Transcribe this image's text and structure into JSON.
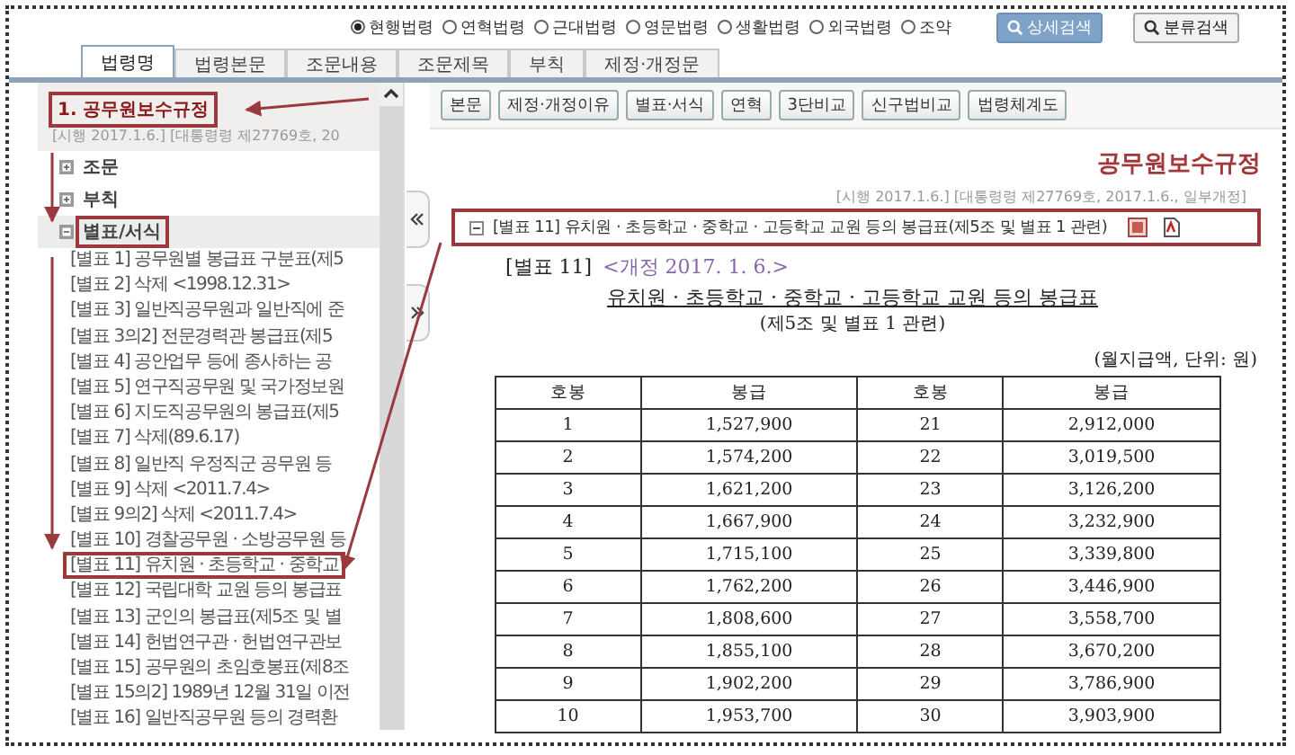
{
  "search_scope": {
    "options": [
      {
        "label": "현행법령",
        "selected": true
      },
      {
        "label": "연혁법령",
        "selected": false
      },
      {
        "label": "근대법령",
        "selected": false
      },
      {
        "label": "영문법령",
        "selected": false
      },
      {
        "label": "생활법령",
        "selected": false
      },
      {
        "label": "외국법령",
        "selected": false
      },
      {
        "label": "조약",
        "selected": false
      }
    ],
    "buttons": [
      {
        "kind": "primary",
        "label": "상세검색"
      },
      {
        "kind": "plain",
        "label": "분류검색"
      }
    ]
  },
  "tabs": [
    {
      "label": "법령명",
      "selected": true
    },
    {
      "label": "법령본문",
      "selected": false
    },
    {
      "label": "조문내용",
      "selected": false
    },
    {
      "label": "조문제목",
      "selected": false
    },
    {
      "label": "부칙",
      "selected": false
    },
    {
      "label": "제정·개정문",
      "selected": false
    }
  ],
  "sidebar": {
    "title": "1. 공무원보수규정",
    "title_boxed": true,
    "subtitle": "[시행 2017.1.6.] [대통령령 제27769호, 20",
    "tree": [
      {
        "label": "조문",
        "expanded": false,
        "boxed": false
      },
      {
        "label": "부칙",
        "expanded": false,
        "boxed": false
      },
      {
        "label": "별표/서식",
        "expanded": true,
        "boxed": true,
        "children": [
          {
            "label": "[별표 1] 공무원별 봉급표 구분표(제5",
            "selected": false
          },
          {
            "label": "[별표 2] 삭제 <1998.12.31>",
            "selected": false
          },
          {
            "label": "[별표 3] 일반직공무원과 일반직에 준",
            "selected": false
          },
          {
            "label": "[별표 3의2] 전문경력관 봉급표(제5",
            "selected": false
          },
          {
            "label": "[별표 4] 공안업무 등에 종사하는 공",
            "selected": false
          },
          {
            "label": "[별표 5] 연구직공무원 및 국가정보원",
            "selected": false
          },
          {
            "label": "[별표 6] 지도직공무원의 봉급표(제5",
            "selected": false
          },
          {
            "label": "[별표 7] 삭제(89.6.17)",
            "selected": false
          },
          {
            "label": "[별표 8] 일반직 우정직군 공무원 등",
            "selected": false
          },
          {
            "label": "[별표 9] 삭제 <2011.7.4>",
            "selected": false
          },
          {
            "label": "[별표 9의2] 삭제 <2011.7.4>",
            "selected": false
          },
          {
            "label": "[별표 10] 경찰공무원 · 소방공무원 등",
            "selected": false
          },
          {
            "label": "[별표 11] 유치원 · 초등학교 · 중학교",
            "selected": true
          },
          {
            "label": "[별표 12] 국립대학 교원 등의 봉급표",
            "selected": false
          },
          {
            "label": "[별표 13] 군인의 봉급표(제5조 및 별",
            "selected": false
          },
          {
            "label": "[별표 14] 헌법연구관 · 헌법연구관보",
            "selected": false
          },
          {
            "label": "[별표 15] 공무원의 초임호봉표(제8조",
            "selected": false
          },
          {
            "label": "[별표 15의2] 1989년 12월 31일 이전",
            "selected": false
          },
          {
            "label": "[별표 16] 일반직공무원 등의 경력환",
            "selected": false
          }
        ]
      }
    ]
  },
  "content": {
    "toolbar": [
      "본문",
      "제정·개정이유",
      "별표·서식",
      "연혁",
      "3단비교",
      "신구법비교",
      "법령체계도"
    ],
    "law_title": "공무원보수규정",
    "enforcement": "[시행 2017.1.6.] [대통령령 제27769호, 2017.1.6., 일부개정]",
    "annex_header": "[별표 11] 유치원 · 초등학교 · 중학교 · 고등학교 교원 등의 봉급표(제5조 및 별표 1 관련)",
    "document": {
      "annex_label": "[별표 11]",
      "revision": "<개정 2017. 1. 6.>",
      "title": "유치원 · 초등학교 · 중학교 · 고등학교 교원 등의 봉급표",
      "subtitle": "(제5조 및 별표 1 관련)",
      "unit": "(월지급액, 단위: 원)",
      "columns": [
        "호봉",
        "봉급",
        "호봉",
        "봉급"
      ],
      "rows": [
        [
          "1",
          "1,527,900",
          "21",
          "2,912,000"
        ],
        [
          "2",
          "1,574,200",
          "22",
          "3,019,500"
        ],
        [
          "3",
          "1,621,200",
          "23",
          "3,126,200"
        ],
        [
          "4",
          "1,667,900",
          "24",
          "3,232,900"
        ],
        [
          "5",
          "1,715,100",
          "25",
          "3,339,800"
        ],
        [
          "6",
          "1,762,200",
          "26",
          "3,446,900"
        ],
        [
          "7",
          "1,808,600",
          "27",
          "3,558,700"
        ],
        [
          "8",
          "1,855,100",
          "28",
          "3,670,200"
        ],
        [
          "9",
          "1,902,200",
          "29",
          "3,786,900"
        ],
        [
          "10",
          "1,953,700",
          "30",
          "3,903,900"
        ]
      ]
    }
  }
}
